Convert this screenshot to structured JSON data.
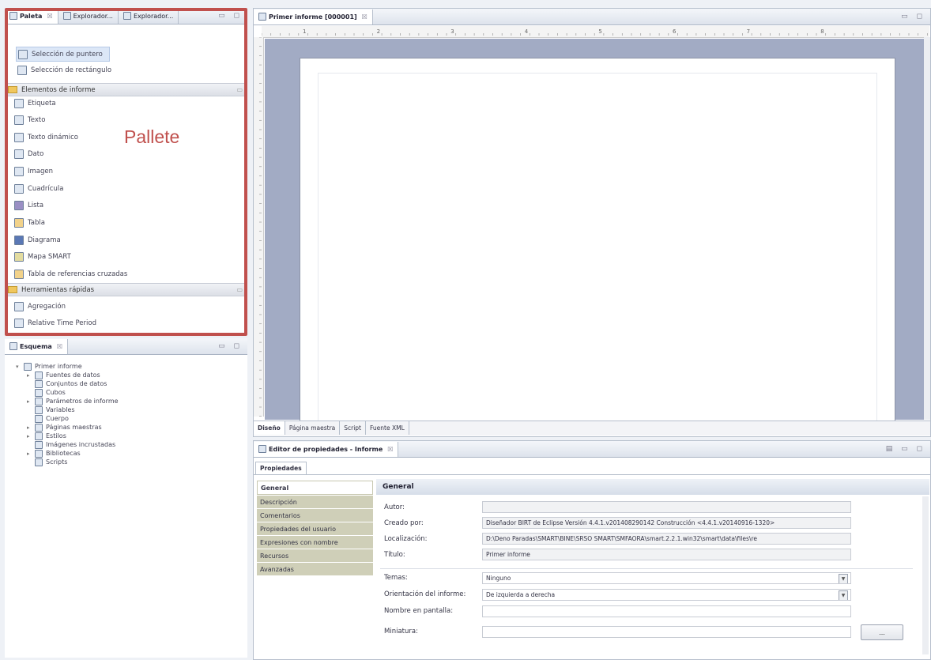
{
  "palette": {
    "tabs": [
      {
        "label": "Paleta",
        "close": "☒"
      },
      {
        "label": "Explorador..."
      },
      {
        "label": "Explorador..."
      }
    ],
    "window_buttons": "▭ ◻",
    "selection_tools": [
      "Selección de puntero",
      "Selección de rectángulo"
    ],
    "sections": [
      {
        "title": "Elementos de informe",
        "collapse": "▭"
      },
      {
        "title": "Herramientas rápidas",
        "collapse": "▭"
      }
    ],
    "report_items": [
      "Etiqueta",
      "Texto",
      "Texto dinámico",
      "Dato",
      "Imagen",
      "Cuadrícula",
      "Lista",
      "Tabla",
      "Diagrama",
      "Mapa SMART",
      "Tabla de referencias cruzadas"
    ],
    "quick_tools": [
      "Agregación",
      "Relative Time Period"
    ]
  },
  "annotation": {
    "label": "Pallete",
    "color": "#c0504d"
  },
  "outline": {
    "tab": "Esquema",
    "window_buttons": "▭ ◻",
    "tree": [
      {
        "label": "Primer informe",
        "level": 0,
        "toggle": "▾"
      },
      {
        "label": "Fuentes de datos",
        "level": 1,
        "toggle": "▸"
      },
      {
        "label": "Conjuntos de datos",
        "level": 1,
        "toggle": ""
      },
      {
        "label": "Cubos",
        "level": 1,
        "toggle": ""
      },
      {
        "label": "Parámetros de informe",
        "level": 1,
        "toggle": "▸"
      },
      {
        "label": "Variables",
        "level": 1,
        "toggle": ""
      },
      {
        "label": "Cuerpo",
        "level": 1,
        "toggle": ""
      },
      {
        "label": "Páginas maestras",
        "level": 1,
        "toggle": "▸"
      },
      {
        "label": "Estilos",
        "level": 1,
        "toggle": "▸"
      },
      {
        "label": "Imágenes incrustadas",
        "level": 1,
        "toggle": ""
      },
      {
        "label": "Bibliotecas",
        "level": 1,
        "toggle": "▸"
      },
      {
        "label": "Scripts",
        "level": 1,
        "toggle": ""
      }
    ]
  },
  "editor": {
    "tab": "Primer informe [000001]",
    "window_buttons": "▭ ◻",
    "ruler_numbers": [
      "1",
      "2",
      "3",
      "4",
      "5",
      "6",
      "7",
      "8"
    ],
    "bottom_tabs": [
      "Diseño",
      "Página maestra",
      "Script",
      "Fuente XML"
    ]
  },
  "properties": {
    "tab": "Editor de propiedades - Informe",
    "window_buttons": "▤ ▭ ◻",
    "subtab": "Propiedades",
    "categories": [
      "General",
      "Descripción",
      "Comentarios",
      "Propiedades del usuario",
      "Expresiones con nombre",
      "Recursos",
      "Avanzadas"
    ],
    "section_title": "General",
    "fields": {
      "autor": {
        "label": "Autor:",
        "value": ""
      },
      "creado_por": {
        "label": "Creado por:",
        "value": "Diseñador BIRT de Eclipse Versión 4.4.1.v201408290142 Construcción <4.4.1.v20140916-1320>"
      },
      "localizacion": {
        "label": "Localización:",
        "value": "D:\\Deno Paradas\\SMART\\BINE\\SRSO SMART\\SMFAORA\\smart.2.2.1.win32\\smart\\data\\files\\re"
      },
      "titulo": {
        "label": "Título:",
        "value": "Primer informe"
      },
      "temas": {
        "label": "Temas:",
        "value": "Ninguno"
      },
      "orientacion": {
        "label": "Orientación del informe:",
        "value": "De izquierda a derecha"
      },
      "nombre_pantalla": {
        "label": "Nombre en pantalla:",
        "value": ""
      },
      "miniatura": {
        "label": "Miniatura:",
        "value": ""
      }
    },
    "ellipsis_button": "..."
  }
}
